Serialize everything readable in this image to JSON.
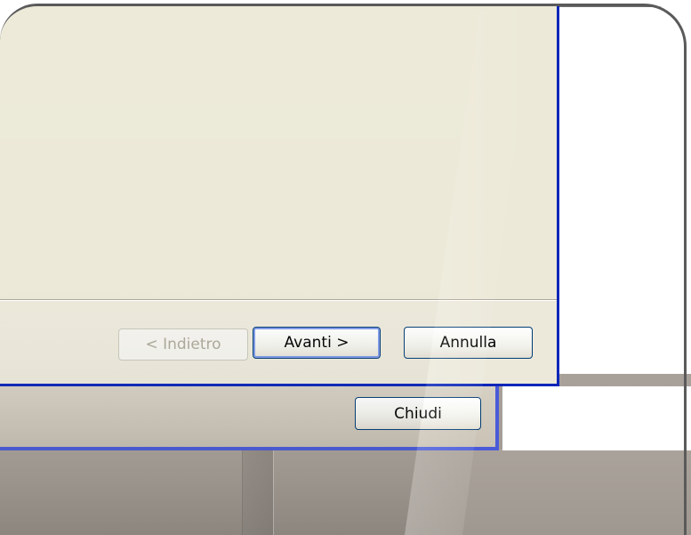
{
  "wizard": {
    "buttons": {
      "back_label": "< Indietro",
      "next_label": "Avanti >",
      "cancel_label": "Annulla"
    }
  },
  "parent_dialog": {
    "close_label": "Chiudi"
  },
  "colors": {
    "dialog_face": "#ece9d8",
    "window_border": "#0a26b8",
    "back_window_border": "#4a5bd8",
    "button_border": "#003c74",
    "disabled_text": "#aca899"
  }
}
